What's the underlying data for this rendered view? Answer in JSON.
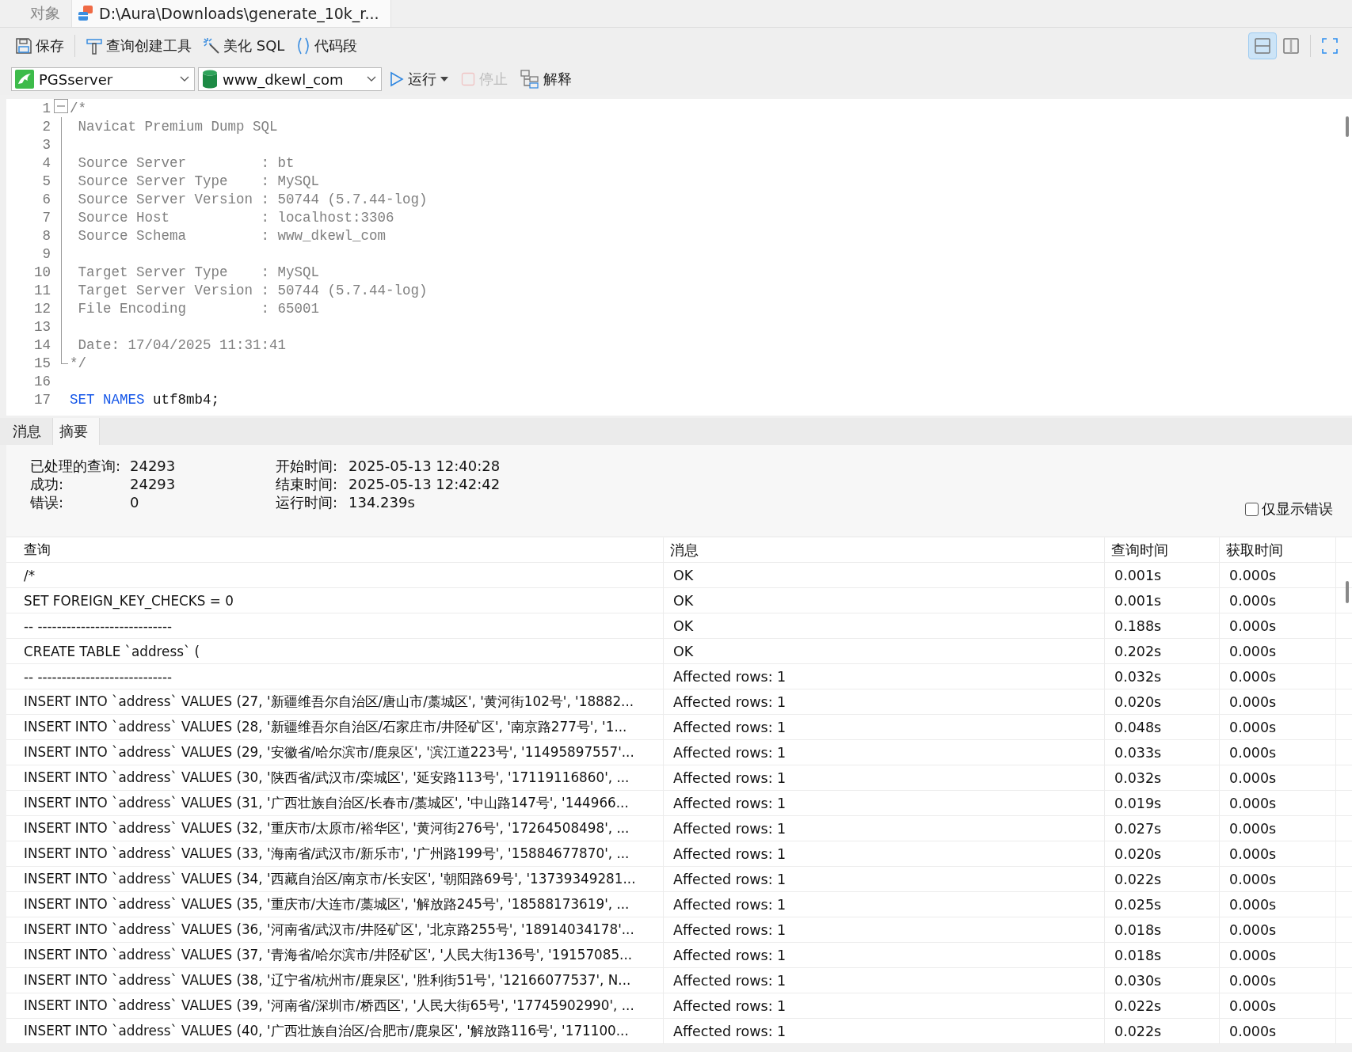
{
  "document_tabs": [
    {
      "label": "对象",
      "selected": false
    },
    {
      "label": "D:\\Aura\\Downloads\\generate_10k_r...",
      "selected": true
    }
  ],
  "toolbar": {
    "buttons": [
      {
        "label": "保存"
      },
      {
        "label": "查询创建工具"
      },
      {
        "label": "美化 SQL"
      },
      {
        "label": "代码段"
      }
    ],
    "view_buttons": [
      {
        "kind": "split-horizontal",
        "selected": true
      },
      {
        "kind": "split-vertical",
        "selected": false
      },
      {
        "kind": "fullscreen",
        "selected": false
      }
    ]
  },
  "connection": {
    "server": "PGSserver",
    "database": "www_dkewl_com"
  },
  "run_bar": [
    {
      "label": "运行",
      "kind": "run",
      "disabled": false
    },
    {
      "label": "停止",
      "kind": "stop",
      "disabled": true
    },
    {
      "label": "解释",
      "kind": "explain",
      "disabled": false
    }
  ],
  "editor": {
    "lines": [
      {
        "number": "1",
        "expanded": true,
        "segments": [
          {
            "text": "/*",
            "kind": "comment"
          }
        ],
        "children": [
          {
            "number": "2",
            "segments": [
              {
                "text": " Navicat Premium Dump SQL",
                "kind": "comment"
              }
            ]
          },
          {
            "number": "3"
          },
          {
            "number": "4",
            "segments": [
              {
                "text": " Source Server         : bt",
                "kind": "comment"
              }
            ]
          },
          {
            "number": "5",
            "segments": [
              {
                "text": " Source Server Type    : MySQL",
                "kind": "comment"
              }
            ]
          },
          {
            "number": "6",
            "segments": [
              {
                "text": " Source Server Version : 50744 (5.7.44-log)",
                "kind": "comment"
              }
            ]
          },
          {
            "number": "7",
            "segments": [
              {
                "text": " Source Host           : localhost:3306",
                "kind": "comment"
              }
            ]
          },
          {
            "number": "8",
            "segments": [
              {
                "text": " Source Schema         : www_dkewl_com",
                "kind": "comment"
              }
            ]
          },
          {
            "number": "9"
          },
          {
            "number": "10",
            "segments": [
              {
                "text": " Target Server Type    : MySQL",
                "kind": "comment"
              }
            ]
          },
          {
            "number": "11",
            "segments": [
              {
                "text": " Target Server Version : 50744 (5.7.44-log)",
                "kind": "comment"
              }
            ]
          },
          {
            "number": "12",
            "segments": [
              {
                "text": " File Encoding         : 65001",
                "kind": "comment"
              }
            ]
          },
          {
            "number": "13"
          },
          {
            "number": "14",
            "segments": [
              {
                "text": " Date: 17/04/2025 11:31:41",
                "kind": "comment"
              }
            ]
          },
          {
            "number": "15",
            "segments": [
              {
                "text": "*/",
                "kind": "comment"
              }
            ]
          }
        ]
      },
      {
        "number": "16"
      },
      {
        "number": "17",
        "segments": [
          {
            "text": "SET",
            "kind": "keyword"
          },
          {
            "text": "NAMES",
            "kind": "keyword"
          },
          {
            "text": "utf8mb4;",
            "kind": "plain"
          }
        ]
      }
    ]
  },
  "result_tabs": [
    {
      "label": "消息",
      "selected": false
    },
    {
      "label": "摘要",
      "selected": true
    }
  ],
  "summary": {
    "counts": [
      {
        "label": "已处理的查询:",
        "value": "24293"
      },
      {
        "label": "成功:",
        "value": "24293"
      },
      {
        "label": "错误:",
        "value": "0"
      }
    ],
    "times": [
      {
        "label": "开始时间:",
        "value": "2025-05-13 12:40:28"
      },
      {
        "label": "结束时间:",
        "value": "2025-05-13 12:42:42"
      },
      {
        "label": "运行时间:",
        "value": "134.239s"
      }
    ],
    "errors_only": {
      "label": "仅显示错误",
      "checked": false
    }
  },
  "table": {
    "columns": [
      "查询",
      "消息",
      "查询时间",
      "获取时间"
    ],
    "rows": [
      [
        "/*",
        "OK",
        "0.001s",
        "0.000s"
      ],
      [
        "SET FOREIGN_KEY_CHECKS = 0",
        "OK",
        "0.001s",
        "0.000s"
      ],
      [
        "-- ----------------------------",
        "OK",
        "0.188s",
        "0.000s"
      ],
      [
        "CREATE TABLE `address` (",
        "OK",
        "0.202s",
        "0.000s"
      ],
      [
        "-- ----------------------------",
        "Affected rows: 1",
        "0.032s",
        "0.000s"
      ],
      [
        "INSERT INTO `address` VALUES (27, '新疆维吾尔自治区/唐山市/藁城区', '黄河街102号', '18882...",
        "Affected rows: 1",
        "0.020s",
        "0.000s"
      ],
      [
        "INSERT INTO `address` VALUES (28, '新疆维吾尔自治区/石家庄市/井陉矿区', '南京路277号', '1...",
        "Affected rows: 1",
        "0.048s",
        "0.000s"
      ],
      [
        "INSERT INTO `address` VALUES (29, '安徽省/哈尔滨市/鹿泉区', '滨江道223号', '11495897557'...",
        "Affected rows: 1",
        "0.033s",
        "0.000s"
      ],
      [
        "INSERT INTO `address` VALUES (30, '陕西省/武汉市/栾城区', '延安路113号', '17119116860', ...",
        "Affected rows: 1",
        "0.032s",
        "0.000s"
      ],
      [
        "INSERT INTO `address` VALUES (31, '广西壮族自治区/长春市/藁城区', '中山路147号', '144966...",
        "Affected rows: 1",
        "0.019s",
        "0.000s"
      ],
      [
        "INSERT INTO `address` VALUES (32, '重庆市/太原市/裕华区', '黄河街276号', '17264508498', ...",
        "Affected rows: 1",
        "0.027s",
        "0.000s"
      ],
      [
        "INSERT INTO `address` VALUES (33, '海南省/武汉市/新乐市', '广州路199号', '15884677870', ...",
        "Affected rows: 1",
        "0.020s",
        "0.000s"
      ],
      [
        "INSERT INTO `address` VALUES (34, '西藏自治区/南京市/长安区', '朝阳路69号', '13739349281...",
        "Affected rows: 1",
        "0.022s",
        "0.000s"
      ],
      [
        "INSERT INTO `address` VALUES (35, '重庆市/大连市/藁城区', '解放路245号', '18588173619', ...",
        "Affected rows: 1",
        "0.025s",
        "0.000s"
      ],
      [
        "INSERT INTO `address` VALUES (36, '河南省/武汉市/井陉矿区', '北京路255号', '18914034178'...",
        "Affected rows: 1",
        "0.018s",
        "0.000s"
      ],
      [
        "INSERT INTO `address` VALUES (37, '青海省/哈尔滨市/井陉矿区', '人民大街136号', '19157085...",
        "Affected rows: 1",
        "0.018s",
        "0.000s"
      ],
      [
        "INSERT INTO `address` VALUES (38, '辽宁省/杭州市/鹿泉区', '胜利街51号', '12166077537', N...",
        "Affected rows: 1",
        "0.030s",
        "0.000s"
      ],
      [
        "INSERT INTO `address` VALUES (39, '河南省/深圳市/桥西区', '人民大街65号', '17745902990', ...",
        "Affected rows: 1",
        "0.022s",
        "0.000s"
      ],
      [
        "INSERT INTO `address` VALUES (40, '广西壮族自治区/合肥市/鹿泉区', '解放路116号', '171100...",
        "Affected rows: 1",
        "0.022s",
        "0.000s"
      ]
    ]
  }
}
